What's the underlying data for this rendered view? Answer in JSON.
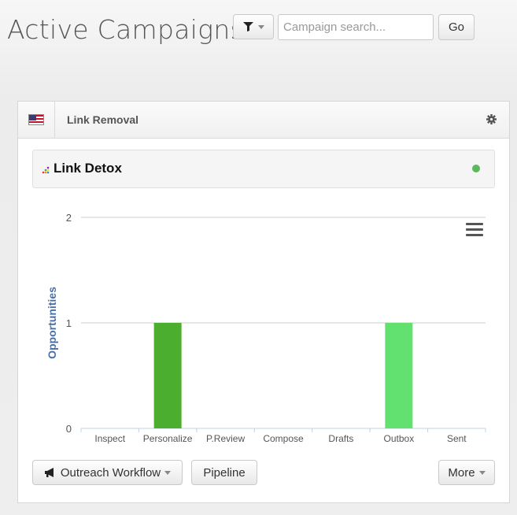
{
  "header": {
    "title": "Active Campaigns",
    "search_placeholder": "Campaign search...",
    "go_label": "Go"
  },
  "campaign": {
    "name": "Link Removal",
    "flag": "us-flag",
    "tool": "Link Detox",
    "status_color": "#5cb85c",
    "buttons": {
      "workflow": "Outreach Workflow",
      "pipeline": "Pipeline",
      "more": "More"
    }
  },
  "chart_data": {
    "type": "bar",
    "categories": [
      "Inspect",
      "Personalize",
      "P.Review",
      "Compose",
      "Drafts",
      "Outbox",
      "Sent"
    ],
    "values": [
      0,
      1,
      0,
      0,
      0,
      1,
      0
    ],
    "colors": [
      "#4cae2e",
      "#4cae2e",
      "#4cae2e",
      "#4cae2e",
      "#4cae2e",
      "#62e070",
      "#4cae2e"
    ],
    "ylabel": "Opportunities",
    "ylim": [
      0,
      2
    ],
    "yticks": [
      0,
      1,
      2
    ],
    "grid": true
  }
}
